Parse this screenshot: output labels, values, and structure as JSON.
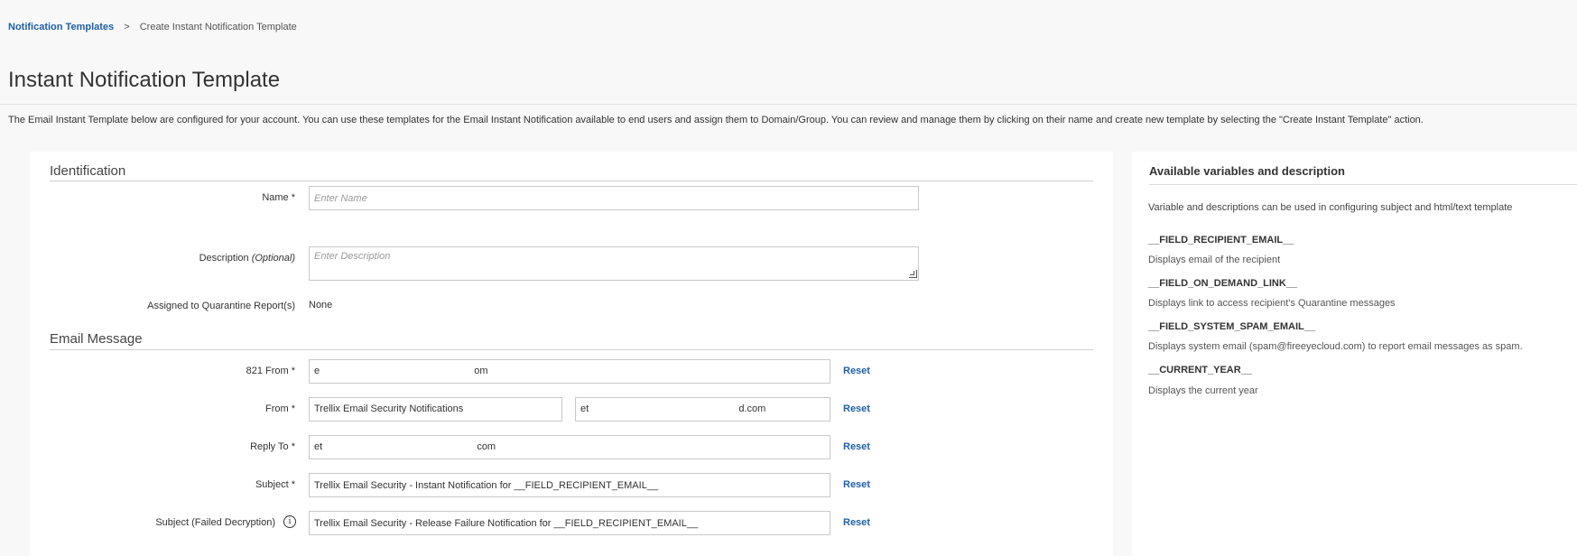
{
  "breadcrumb": {
    "parent": "Notification Templates",
    "separator": ">",
    "current": "Create Instant Notification Template"
  },
  "page_title": "Instant Notification Template",
  "intro": "The Email Instant Template below are configured for your account. You can use these templates for the Email Instant Notification available to end users and assign them to Domain/Group. You can review and manage them by clicking on their name and create new template by selecting the \"Create Instant Template\" action.",
  "identification": {
    "title": "Identification",
    "name_label": "Name *",
    "name_placeholder": "Enter Name",
    "description_label": "Description",
    "description_optional": "(Optional)",
    "description_placeholder": "Enter Description",
    "assigned_label": "Assigned to Quarantine Report(s)",
    "assigned_value": "None"
  },
  "email_message": {
    "title": "Email Message",
    "from821_label": "821 From *",
    "from821_value_prefix": "e",
    "from821_value_suffix": "om",
    "from_label": "From *",
    "from_name_value": "Trellix Email Security Notifications",
    "from_email_prefix": "et",
    "from_email_suffix": "d.com",
    "reply_to_label": "Reply To *",
    "reply_to_prefix": "et",
    "reply_to_suffix": "com",
    "subject_label": "Subject *",
    "subject_value": "Trellix Email Security - Instant Notification for __FIELD_RECIPIENT_EMAIL__",
    "subject_failed_label": "Subject (Failed Decryption)",
    "subject_failed_value": "Trellix Email Security - Release Failure Notification for __FIELD_RECIPIENT_EMAIL__",
    "reset_label": "Reset"
  },
  "variables": {
    "title": "Available variables and description",
    "intro": "Variable and descriptions can be used in configuring subject and html/text template",
    "items": [
      {
        "name": "__FIELD_RECIPIENT_EMAIL__",
        "desc": "Displays email of the recipient"
      },
      {
        "name": "__FIELD_ON_DEMAND_LINK__",
        "desc": "Displays link to access recipient's Quarantine messages"
      },
      {
        "name": "__FIELD_SYSTEM_SPAM_EMAIL__",
        "desc": "Displays system email (spam@fireeyecloud.com) to report email messages as spam."
      },
      {
        "name": "__CURRENT_YEAR__",
        "desc": "Displays the current year"
      }
    ]
  },
  "colors": {
    "link": "#1f5fa8",
    "page_bg": "#f8f8f8",
    "card_bg": "#ffffff"
  }
}
